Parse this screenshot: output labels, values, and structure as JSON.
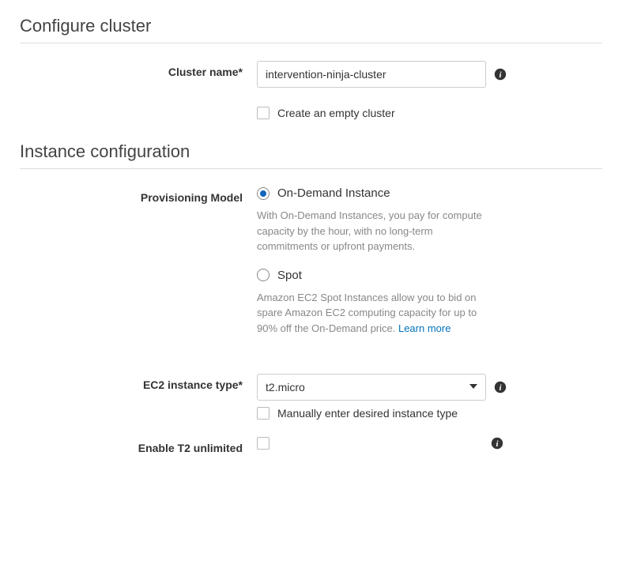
{
  "sections": {
    "configure_cluster": "Configure cluster",
    "instance_configuration": "Instance configuration"
  },
  "cluster_name": {
    "label": "Cluster name*",
    "value": "intervention-ninja-cluster"
  },
  "empty_cluster": {
    "label": "Create an empty cluster"
  },
  "provisioning": {
    "label": "Provisioning Model",
    "on_demand": {
      "label": "On-Demand Instance",
      "help": "With On-Demand Instances, you pay for compute capacity by the hour, with no long-term commitments or upfront payments."
    },
    "spot": {
      "label": "Spot",
      "help": "Amazon EC2 Spot Instances allow you to bid on spare Amazon EC2 computing capacity for up to 90% off the On-Demand price. ",
      "learn_more": "Learn more"
    }
  },
  "instance_type": {
    "label": "EC2 instance type*",
    "value": "t2.micro",
    "manual_label": "Manually enter desired instance type"
  },
  "t2_unlimited": {
    "label": "Enable T2 unlimited"
  }
}
